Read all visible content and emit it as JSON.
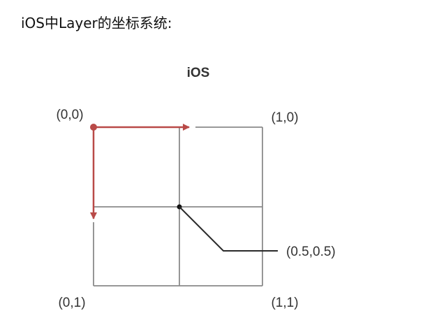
{
  "heading": "iOS中Layer的坐标系统:",
  "diagram": {
    "title": "iOS",
    "corner_labels": {
      "top_left": "(0,0)",
      "top_right": "(1,0)",
      "bottom_left": "(0,1)",
      "bottom_right": "(1,1)"
    },
    "center_label": "(0.5,0.5)",
    "colors": {
      "grid": "#8a8a8a",
      "axis_arrow": "#b94a48",
      "leader": "#2a2a2a",
      "text": "#333333"
    }
  }
}
